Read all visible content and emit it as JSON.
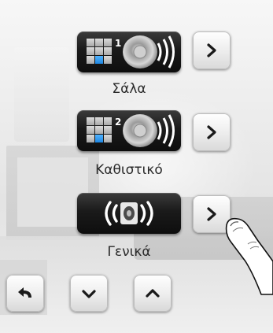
{
  "zones": [
    {
      "label": "Σάλα",
      "number": "1",
      "grid_icon": "grid-icon",
      "speaker_icon": "speaker-icon",
      "arrow_icon": "chevron-right-icon"
    },
    {
      "label": "Καθιστικό",
      "number": "2",
      "grid_icon": "grid-icon",
      "speaker_icon": "speaker-icon",
      "arrow_icon": "chevron-right-icon"
    },
    {
      "label": "Γενικά",
      "number": "",
      "grid_icon": "",
      "speaker_icon": "all-zones-speaker-icon",
      "arrow_icon": "chevron-right-icon"
    }
  ],
  "nav": {
    "back_icon": "back-arrow-icon",
    "down_icon": "chevron-down-icon",
    "up_icon": "chevron-up-icon"
  },
  "overlay": {
    "pointer_icon": "pointing-finger-icon"
  },
  "colors": {
    "accent_blue": "#2a9bf5",
    "button_dark": "#151515",
    "button_light": "#ececec"
  }
}
